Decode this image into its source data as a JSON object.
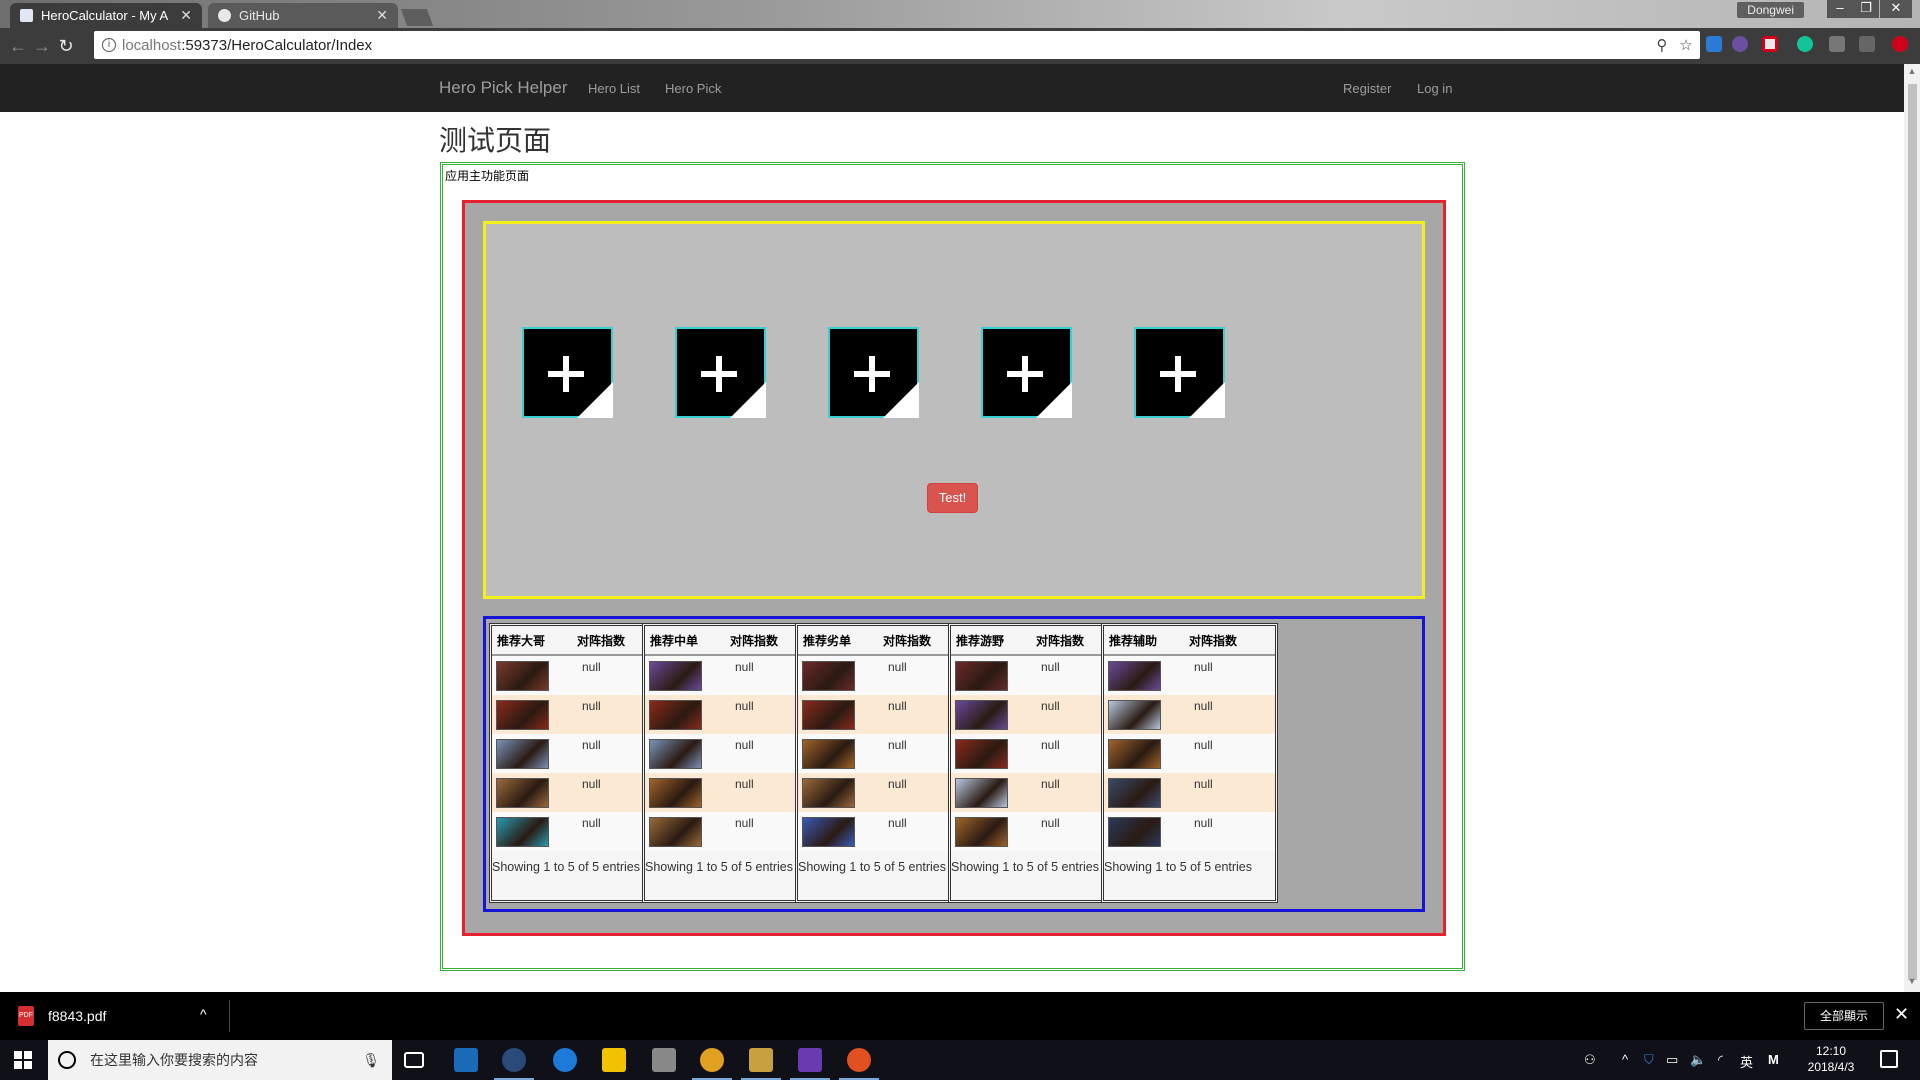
{
  "browser": {
    "tabs": [
      {
        "title": "HeroCalculator - My A",
        "active": true
      },
      {
        "title": "GitHub",
        "active": false
      }
    ],
    "profile_name": "Dongwei",
    "url_host": "localhost",
    "url_rest": ":59373/HeroCalculator/Index"
  },
  "site": {
    "brand": "Hero Pick Helper",
    "nav": {
      "hero_list": "Hero List",
      "hero_pick": "Hero Pick",
      "register": "Register",
      "login": "Log in"
    },
    "page_title": "测试页面",
    "section_title": "应用主功能页面",
    "test_button": "Test!",
    "pick_slots": 5,
    "panels": [
      {
        "heading": "推荐大哥",
        "score_heading": "对阵指数",
        "rows": [
          {
            "value": "null",
            "hero_color": "#7a3a2a"
          },
          {
            "value": "null",
            "hero_color": "#8a2a1a"
          },
          {
            "value": "null",
            "hero_color": "#7a93b8"
          },
          {
            "value": "null",
            "hero_color": "#9a6a3a"
          },
          {
            "value": "null",
            "hero_color": "#2a9ab0"
          }
        ],
        "info": "Showing 1 to 5 of 5 entries"
      },
      {
        "heading": "推荐中单",
        "score_heading": "对阵指数",
        "rows": [
          {
            "value": "null",
            "hero_color": "#6a4a9a"
          },
          {
            "value": "null",
            "hero_color": "#8a2a1a"
          },
          {
            "value": "null",
            "hero_color": "#7a93b8"
          },
          {
            "value": "null",
            "hero_color": "#a0642a"
          },
          {
            "value": "null",
            "hero_color": "#9a6a3a"
          }
        ],
        "info": "Showing 1 to 5 of 5 entries"
      },
      {
        "heading": "推荐劣单",
        "score_heading": "对阵指数",
        "rows": [
          {
            "value": "null",
            "hero_color": "#6a2a2a"
          },
          {
            "value": "null",
            "hero_color": "#8a2a1a"
          },
          {
            "value": "null",
            "hero_color": "#a0642a"
          },
          {
            "value": "null",
            "hero_color": "#9a6a3a"
          },
          {
            "value": "null",
            "hero_color": "#3a5ab8"
          }
        ],
        "info": "Showing 1 to 5 of 5 entries"
      },
      {
        "heading": "推荐游野",
        "score_heading": "对阵指数",
        "rows": [
          {
            "value": "null",
            "hero_color": "#6a2a2a"
          },
          {
            "value": "null",
            "hero_color": "#6a4a9a"
          },
          {
            "value": "null",
            "hero_color": "#8a2a1a"
          },
          {
            "value": "null",
            "hero_color": "#b8c8e0"
          },
          {
            "value": "null",
            "hero_color": "#a0642a"
          }
        ],
        "info": "Showing 1 to 5 of 5 entries"
      },
      {
        "heading": "推荐辅助",
        "score_heading": "对阵指数",
        "rows": [
          {
            "value": "null",
            "hero_color": "#6a4a9a"
          },
          {
            "value": "null",
            "hero_color": "#b8c8e0"
          },
          {
            "value": "null",
            "hero_color": "#a0642a"
          },
          {
            "value": "null",
            "hero_color": "#3a4a6a"
          },
          {
            "value": "null",
            "hero_color": "#2a3a5a"
          }
        ],
        "info": "Showing 1 to 5 of 5 entries"
      }
    ]
  },
  "downloads": {
    "file_name": "f8843.pdf",
    "file_type": "PDF",
    "show_all": "全部顯示"
  },
  "taskbar": {
    "search_placeholder": "在这里输入你要搜索的内容",
    "ime": "英",
    "time": "12:10",
    "date": "2018/4/3"
  }
}
